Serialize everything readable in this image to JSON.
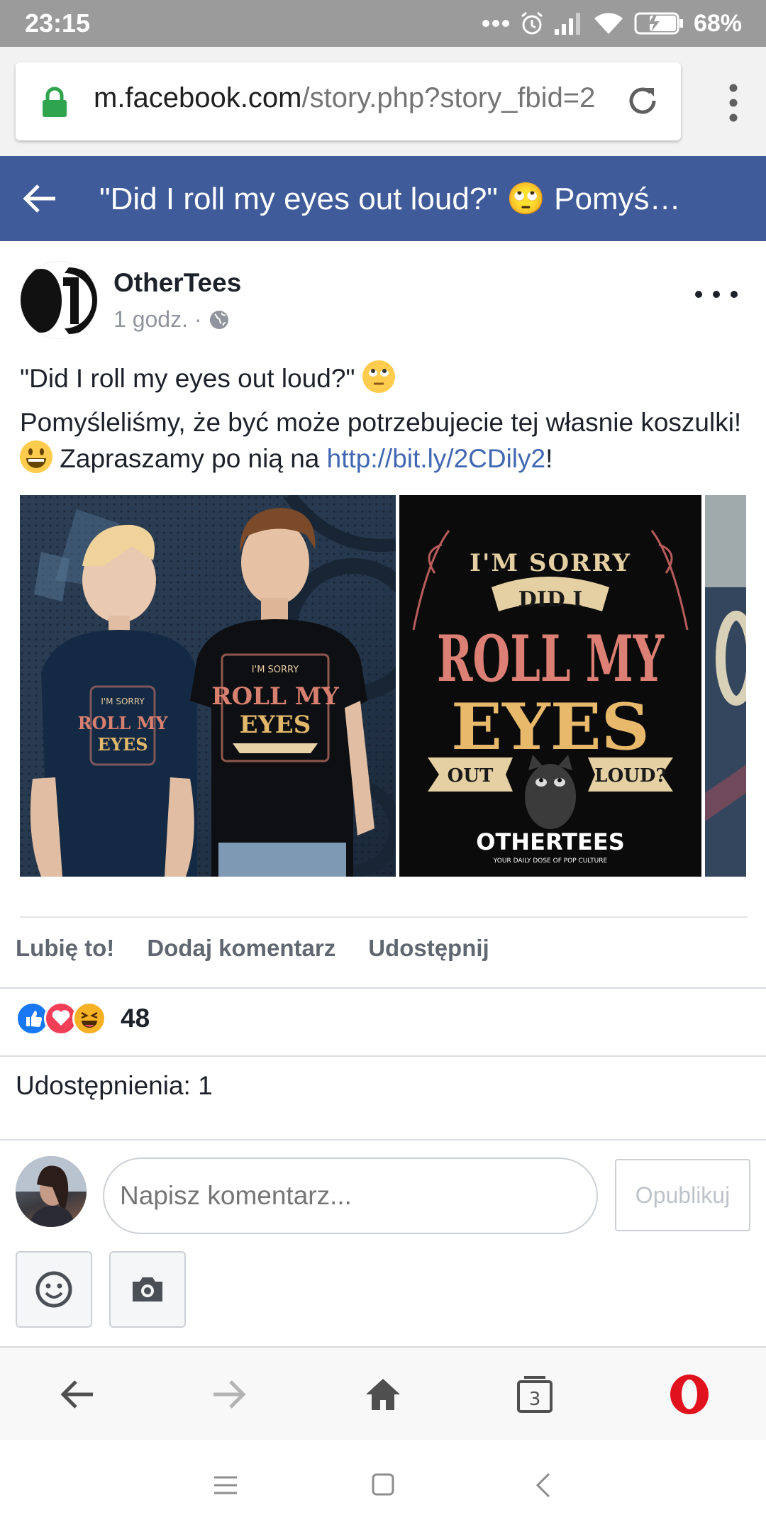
{
  "status_bar": {
    "time": "23:15",
    "battery": "68%"
  },
  "browser": {
    "url_host": "m.facebook.com",
    "url_path": "/story.php?story_fbid=2"
  },
  "header": {
    "title": "\"Did I roll my eyes out loud?\" 🙄 Pomyśl…"
  },
  "post": {
    "page_name": "OtherTees",
    "time": "1 godz. ·",
    "line1": "\"Did I roll my eyes out loud?\"",
    "line2_a": "Pomyśleliśmy, że być może potrzebujecie tej własnie koszulki!",
    "line2_b": "Zapraszamy po nią na",
    "link": "http://bit.ly/2CDily2",
    "link_suffix": "!"
  },
  "shirt_art": {
    "line1": "I'M SORRY",
    "line2": "DID I",
    "line3": "ROLL MY",
    "line4": "EYES",
    "ribbon_left": "OUT",
    "ribbon_right": "LOUD?",
    "brand": "OTHERTEES",
    "tagline": "YOUR DAILY DOSE OF POP CULTURE"
  },
  "actions": {
    "like": "Lubię to!",
    "comment": "Dodaj komentarz",
    "share": "Udostępnij"
  },
  "reactions": {
    "count": "48",
    "types": [
      "like",
      "love",
      "haha"
    ]
  },
  "shares": "Udostępnienia: 1",
  "comment_box": {
    "placeholder": "Napisz komentarz...",
    "publish": "Opublikuj"
  },
  "icons": [
    "lock-icon",
    "reload-icon",
    "menu-dots-icon",
    "back-arrow-icon",
    "globe-icon",
    "more-icon",
    "emoji-icon",
    "camera-icon",
    "nav-back-icon",
    "nav-forward-icon",
    "home-icon",
    "tabs-icon",
    "opera-icon"
  ],
  "tabs_count": "3",
  "colors": {
    "fb_blue": "#3f5b99",
    "link": "#4267b2",
    "status_bar": "#9b9b9b"
  }
}
